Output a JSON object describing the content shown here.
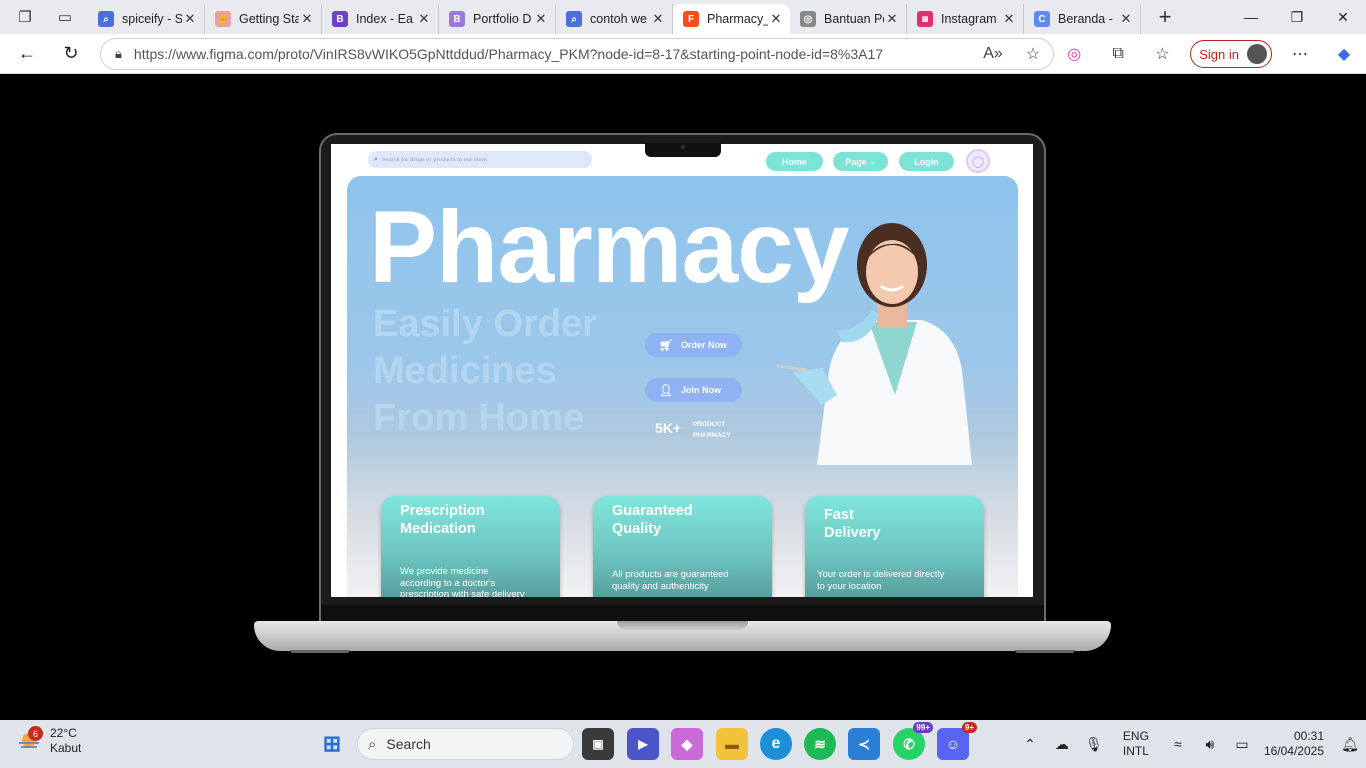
{
  "browser": {
    "tabs": [
      {
        "title": "spiceify - S",
        "fav_color": "#4a6fd8",
        "fav_glyph": "⌕"
      },
      {
        "title": "Getting Sta",
        "fav_color": "#e8a0a0",
        "fav_glyph": "✌"
      },
      {
        "title": "Index - Ea",
        "fav_color": "#6f42c1",
        "fav_glyph": "B"
      },
      {
        "title": "Portfolio D",
        "fav_color": "#9b7ad6",
        "fav_glyph": "B"
      },
      {
        "title": "contoh we",
        "fav_color": "#4a6fd8",
        "fav_glyph": "⌕"
      },
      {
        "title": "Pharmacy_",
        "fav_color": "#f24e1e",
        "fav_glyph": "F"
      },
      {
        "title": "Bantuan Pe",
        "fav_color": "#888888",
        "fav_glyph": "◎"
      },
      {
        "title": "Instagram",
        "fav_color": "#e1306c",
        "fav_glyph": "◙"
      },
      {
        "title": "Beranda -",
        "fav_color": "#5b8def",
        "fav_glyph": "C"
      }
    ],
    "active_tab": 5,
    "url": "https://www.figma.com/proto/VinIRS8vWIKO5GpNttddud/Pharmacy_PKM?node-id=8-17&starting-point-node-id=8%3A17",
    "sign_in_label": "Sign in"
  },
  "site": {
    "search_placeholder": "Search for drugs or products in our store",
    "nav": {
      "home": "Home",
      "page": "Page",
      "login": "Login"
    },
    "hero_title": "Pharmacy",
    "tagline": [
      "Easily Order",
      "Medicines",
      "From Home"
    ],
    "order_now": "Order Now",
    "join_now": "Join Now",
    "stat_number": "5K+",
    "stat_label": [
      "PRODUCT",
      "PHARMACY"
    ],
    "cards": [
      {
        "title": [
          "Prescription",
          "Medication"
        ],
        "text": [
          "We provide medicine",
          "according to a doctor's",
          "prescription with safe delivery"
        ]
      },
      {
        "title": [
          "Guaranteed",
          "Quality"
        ],
        "text": [
          "All products are guaranteed",
          "quality and authenticity"
        ]
      },
      {
        "title": [
          "Fast",
          "Delivery"
        ],
        "text": [
          "Your order is delivered directly",
          "to your location"
        ]
      }
    ]
  },
  "taskbar": {
    "weather_temp": "22°C",
    "weather_desc": "Kabut",
    "weather_badge": "6",
    "search_label": "Search",
    "whatsapp_badge": "99+",
    "discord_badge": "9+",
    "lang": [
      "ENG",
      "INTL"
    ],
    "time": "00:31",
    "date": "16/04/2025"
  }
}
